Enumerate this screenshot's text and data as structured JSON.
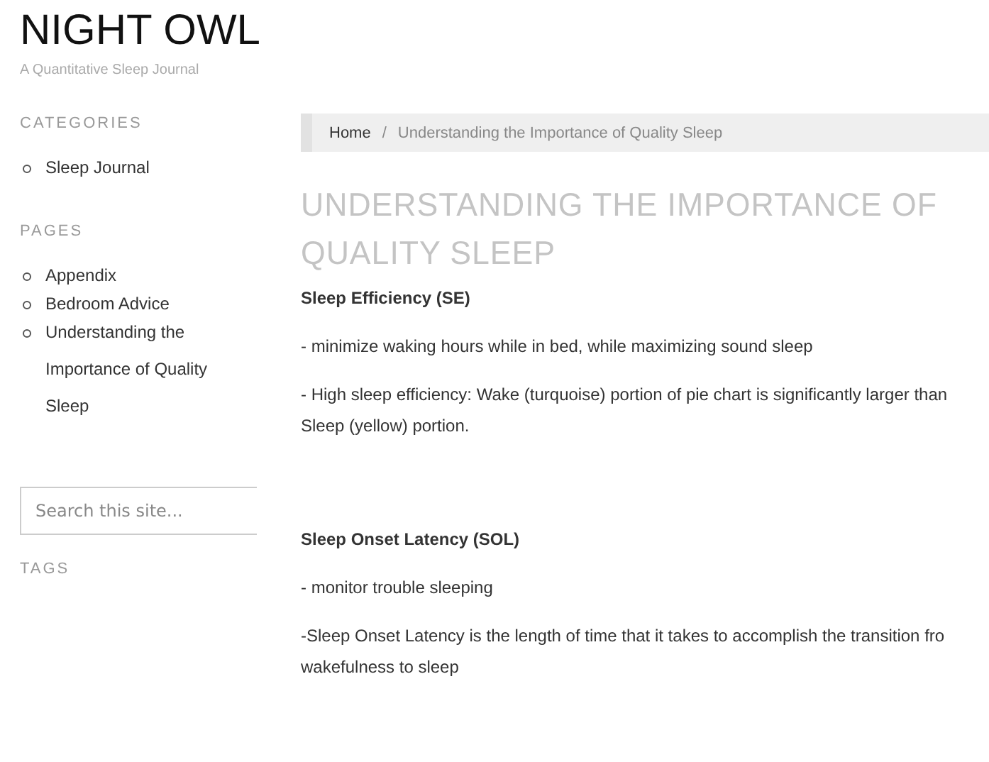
{
  "site": {
    "title": "NIGHT OWL",
    "tagline": "A Quantitative Sleep Journal"
  },
  "sidebar": {
    "sections": [
      {
        "heading": "CATEGORIES",
        "items": [
          "Sleep Journal"
        ]
      },
      {
        "heading": "PAGES",
        "items": [
          "Appendix",
          "Bedroom Advice",
          "Understanding the Importance of Quality Sleep"
        ]
      }
    ],
    "search": {
      "placeholder": "Search this site..."
    },
    "tags_heading": "TAGS"
  },
  "breadcrumb": {
    "home": "Home",
    "separator": "/",
    "current": "Understanding the Importance of Quality Sleep"
  },
  "article": {
    "title": "UNDERSTANDING THE IMPORTANCE OF QUALITY SLEEP",
    "blocks": [
      {
        "kind": "heading",
        "text": "Sleep Efficiency (SE)"
      },
      {
        "kind": "text",
        "text": "- minimize waking hours while in bed, while maximizing sound sleep"
      },
      {
        "kind": "text",
        "text": "- High sleep efficiency: Wake (turquoise) portion of pie chart is significantly larger than Sleep (yellow) portion."
      },
      {
        "kind": "spacer"
      },
      {
        "kind": "heading",
        "text": "Sleep Onset Latency (SOL)"
      },
      {
        "kind": "text",
        "text": "- monitor trouble sleeping"
      },
      {
        "kind": "text",
        "text": "-Sleep Onset Latency is the length of time that it takes to accomplish the transition fro wakefulness to sleep"
      }
    ]
  }
}
